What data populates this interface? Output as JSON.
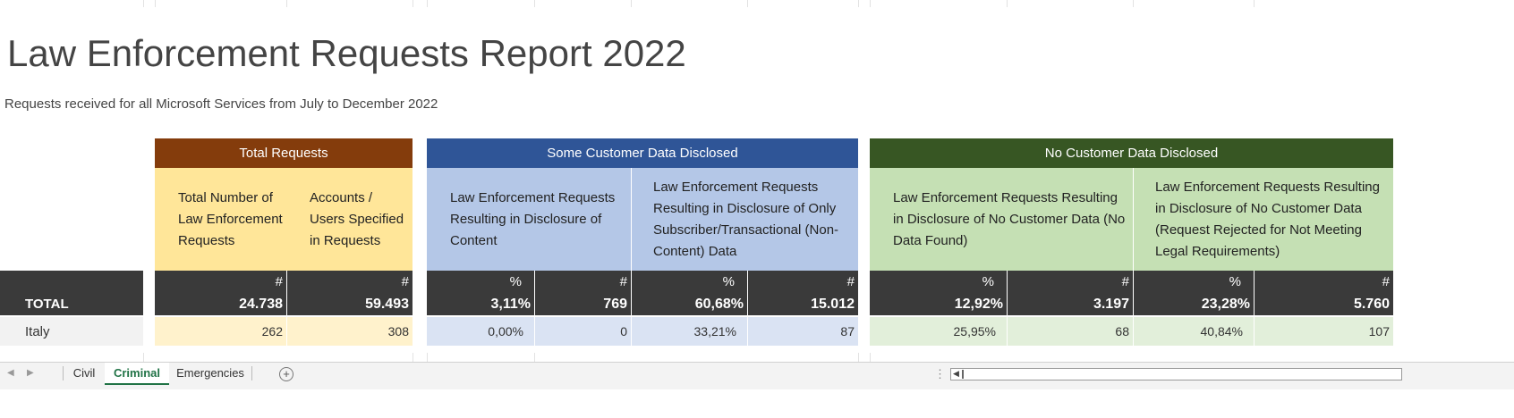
{
  "report": {
    "title": "Law Enforcement Requests Report 2022",
    "subtitle": "Requests received for all Microsoft Services from July to December 2022"
  },
  "groups": {
    "total": "Total Requests",
    "some": "Some Customer Data Disclosed",
    "none": "No Customer Data Disclosed"
  },
  "headers": {
    "total_requests": "Total Number of Law Enforcement Requests",
    "accounts": "Accounts / Users Specified in Requests",
    "content": "Law Enforcement Requests Resulting in Disclosure of Content",
    "subscriber": "Law Enforcement Requests Resulting in Disclosure of Only Subscriber/Transactional (Non-Content) Data",
    "no_data_found": "Law Enforcement Requests Resulting in Disclosure of No Customer Data (No Data Found)",
    "rejected": "Law Enforcement Requests Resulting in Disclosure of No Customer Data (Request Rejected for Not Meeting Legal Requirements)"
  },
  "symbols": {
    "count": "#",
    "percent": "%"
  },
  "total_row": {
    "label": "TOTAL",
    "total_requests": "24.738",
    "accounts": "59.493",
    "content_pct": "3,11%",
    "content_num": "769",
    "subscriber_pct": "60,68%",
    "subscriber_num": "15.012",
    "no_data_pct": "12,92%",
    "no_data_num": "3.197",
    "rejected_pct": "23,28%",
    "rejected_num": "5.760"
  },
  "italy_row": {
    "label": "Italy",
    "total_requests": "262",
    "accounts": "308",
    "content_pct": "0,00%",
    "content_num": "0",
    "subscriber_pct": "33,21%",
    "subscriber_num": "87",
    "no_data_pct": "25,95%",
    "no_data_num": "68",
    "rejected_pct": "40,84%",
    "rejected_num": "107"
  },
  "sheet_tabs": [
    {
      "label": "Civil",
      "active": false
    },
    {
      "label": "Criminal",
      "active": true
    },
    {
      "label": "Emergencies",
      "active": false
    }
  ],
  "add_sheet_label": "+",
  "colors": {
    "brown_band": "#843c0c",
    "blue_band": "#2f5597",
    "green_band": "#375623",
    "brown_header": "#ffe699",
    "blue_header": "#b4c7e7",
    "green_header": "#c5e0b4",
    "dark_row": "#3a3a3a",
    "active_tab": "#217346"
  }
}
